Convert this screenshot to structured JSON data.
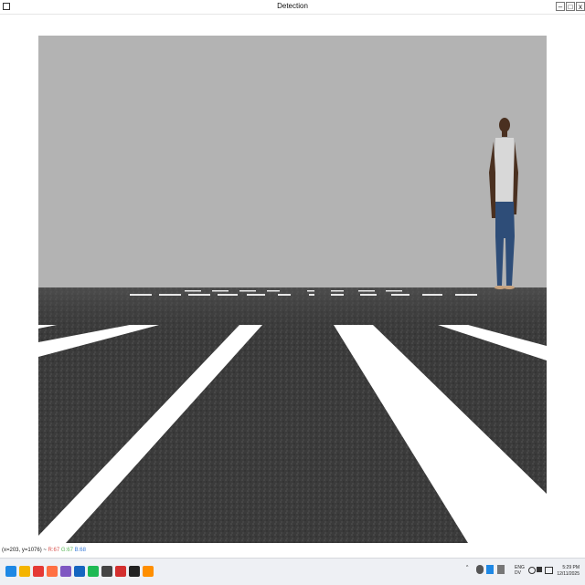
{
  "window": {
    "title": "Detection",
    "minimize_label": "–",
    "maximize_label": "□",
    "close_label": "x"
  },
  "status": {
    "coords": "(x=203, y=1076) ~",
    "r": "R:67",
    "g": "G:67",
    "b": "B:68"
  },
  "scene": {
    "sky_color": "#b3b3b3",
    "road_color": "#3a3a3a",
    "stripe_color": "#ffffff"
  },
  "taskbar": {
    "apps": [
      {
        "name": "windows-start-icon",
        "color": "#1e88e5"
      },
      {
        "name": "file-explorer-icon",
        "color": "#f4b400"
      },
      {
        "name": "browser-icon",
        "color": "#e53935"
      },
      {
        "name": "firefox-icon",
        "color": "#ff7043"
      },
      {
        "name": "visual-studio-icon",
        "color": "#7e57c2"
      },
      {
        "name": "todo-check-icon",
        "color": "#1565c0"
      },
      {
        "name": "spotify-icon",
        "color": "#1db954"
      },
      {
        "name": "terminal-icon",
        "color": "#444444"
      },
      {
        "name": "clock-app-icon",
        "color": "#d32f2f"
      },
      {
        "name": "unity-icon",
        "color": "#222222"
      },
      {
        "name": "vlc-icon",
        "color": "#ff8f00"
      }
    ],
    "tray": {
      "lang_top": "ENG",
      "lang_bottom": "DV",
      "time": "5:29 PM",
      "date": "12/11/2025"
    }
  }
}
